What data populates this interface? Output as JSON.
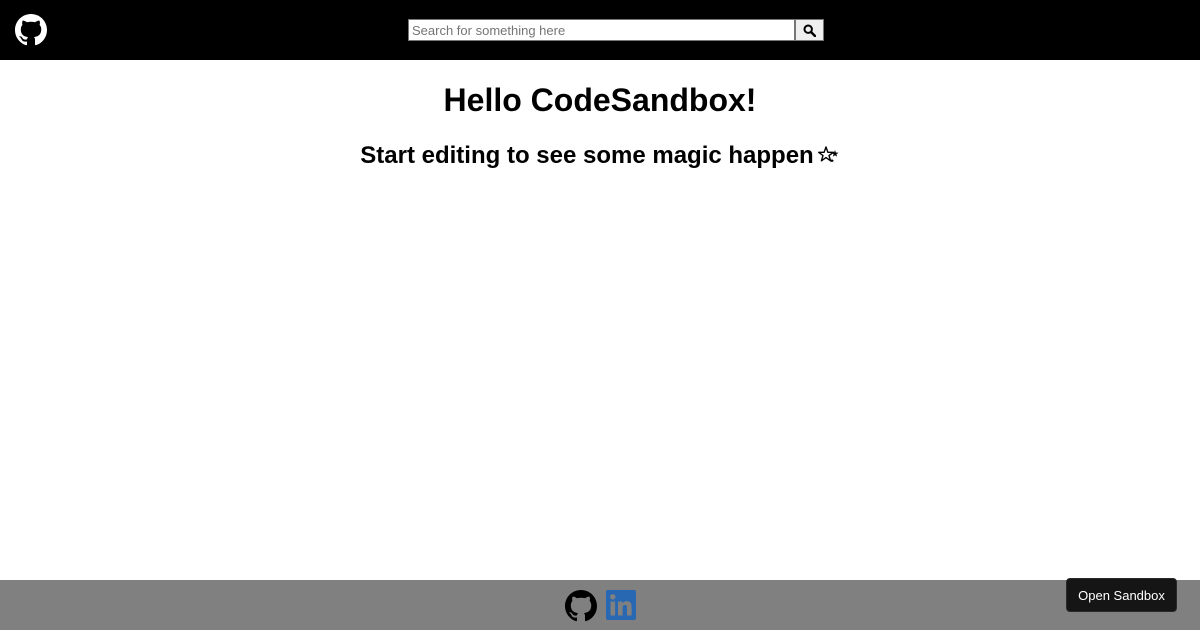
{
  "header": {
    "logo_icon": "github-icon",
    "search": {
      "value": "",
      "placeholder": "Search for something here",
      "button_icon": "search-icon"
    }
  },
  "main": {
    "title": "Hello CodeSandbox!",
    "subtitle": "Start editing to see some magic happen",
    "subtitle_icon": "sparkles-icon"
  },
  "footer": {
    "links": [
      {
        "icon": "github-icon"
      },
      {
        "icon": "linkedin-icon"
      }
    ]
  },
  "open_sandbox_label": "Open Sandbox",
  "colors": {
    "header_bg": "#000000",
    "footer_bg": "#808080",
    "linkedin_blue": "#2867B2",
    "button_bg": "#151515"
  }
}
